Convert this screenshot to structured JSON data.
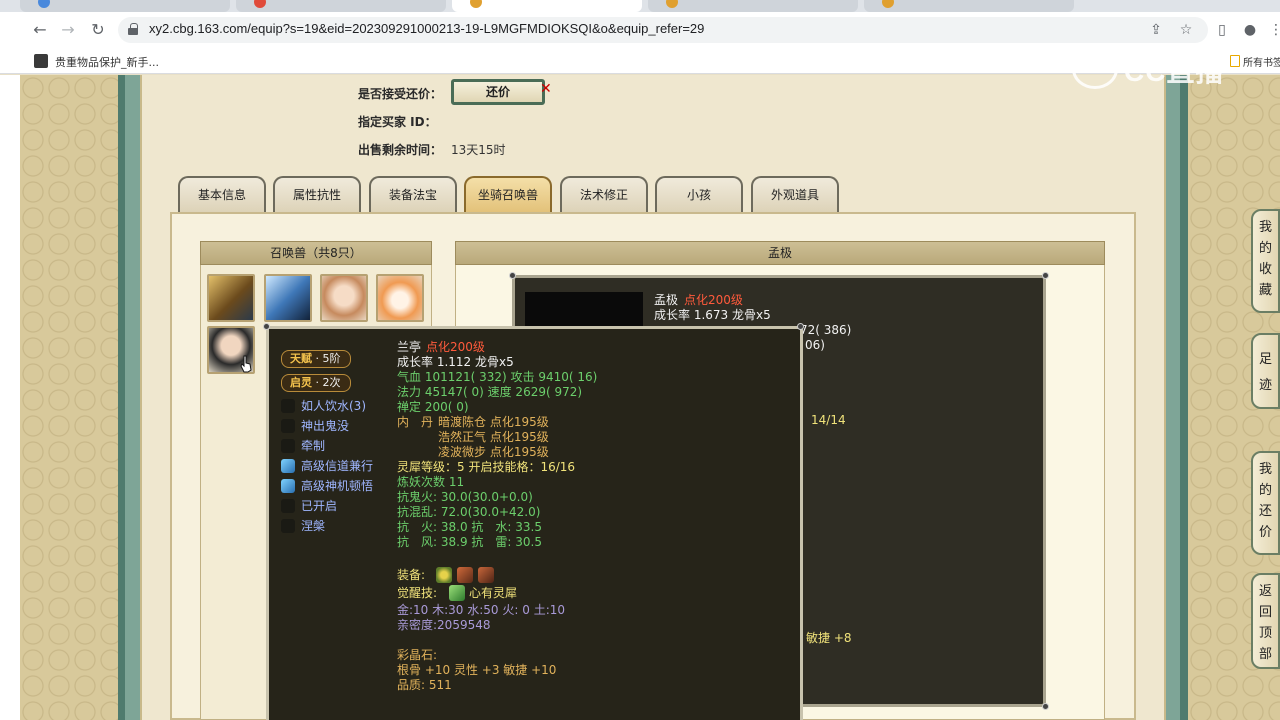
{
  "browser": {
    "url": "xy2.cbg.163.com/equip?s=19&eid=202309291000213-19-L9MGFMDIOKSQI&o&equip_refer=29",
    "bookmark_label": "贵重物品保护_新手...",
    "bookmark_right": "所有书签"
  },
  "watermark": "CC直播",
  "sale": {
    "accept_counter_label": "是否接受还价：",
    "counter_button": "还价",
    "buyer_id_label": "指定买家 ID：",
    "remaining_label": "出售剩余时间：",
    "remaining_value": "13天15时"
  },
  "tabs": [
    {
      "label": "基本信息"
    },
    {
      "label": "属性抗性"
    },
    {
      "label": "装备法宝"
    },
    {
      "label": "坐骑召唤兽"
    },
    {
      "label": "法术修正"
    },
    {
      "label": "小孩"
    },
    {
      "label": "外观道具"
    }
  ],
  "summon_header": "召唤兽（共8只）",
  "detail_header": "孟极",
  "back_panel": {
    "name": "孟极",
    "level": "点化200级",
    "growth": "成长率 1.673 龙骨x5",
    "partial_1": "72( 386)",
    "partial_2": "06)",
    "partial_3": "14/14",
    "partial_4": "敏捷 +8"
  },
  "popup": {
    "talent": {
      "key": "天赋",
      "value": "5阶"
    },
    "spirit": {
      "key": "启灵",
      "value": "2次"
    },
    "skills": [
      {
        "name": "如人饮水(3)",
        "lit": false
      },
      {
        "name": "神出鬼没",
        "lit": false
      },
      {
        "name": "牵制",
        "lit": false
      },
      {
        "name": "高级信道兼行",
        "lit": true
      },
      {
        "name": "高级神机顿悟",
        "lit": true
      },
      {
        "name": "已开启",
        "lit": false
      },
      {
        "name": "涅槃",
        "lit": false
      }
    ],
    "name": "兰亭",
    "level": "点化200级",
    "growth": "成长率 1.112 龙骨x5",
    "hp_line": "气血 101121( 332) 攻击 9410( 16)",
    "mp_line": "法力 45147( 0) 速度 2629( 972)",
    "zen_line": "禅定 200( 0)",
    "neidan_label": "内　丹",
    "neidan": [
      "暗渡陈仓 点化195级",
      "浩然正气 点化195级",
      "凌波微步 点化195级"
    ],
    "spirit_level": "灵犀等级：5 开启技能格：16/16",
    "refine_count": "炼妖次数 11",
    "resist_ghost": "抗鬼火: 30.0(30.0+0.0)",
    "resist_chaos": "抗混乱: 72.0(30.0+42.0)",
    "resist_fire_water": "抗　火: 38.0 抗　水: 33.5",
    "resist_wind_thunder": "抗　风: 38.9 抗　雷: 30.5",
    "equip_label": "装备:",
    "awaken_label": "觉醒技:",
    "awaken_skill": "心有灵犀",
    "elements": "金:10 木:30 水:50 火: 0 土:10",
    "intimacy": "亲密度:2059548",
    "gem_label": "彩晶石:",
    "gem_stats": "根骨 +10 灵性 +3 敏捷 +10",
    "quality": "品质: 511"
  },
  "side_buttons": [
    {
      "label": "我的收藏"
    },
    {
      "label": "足迹"
    },
    {
      "label": "我的还价"
    },
    {
      "label": "返回顶部"
    }
  ],
  "colors": {
    "accent_green": "#6ccf6c",
    "accent_red": "#ff5a3c",
    "accent_yellow": "#f0e27a",
    "accent_purple": "#a99ad8",
    "panel_dark": "#2f2d24"
  }
}
